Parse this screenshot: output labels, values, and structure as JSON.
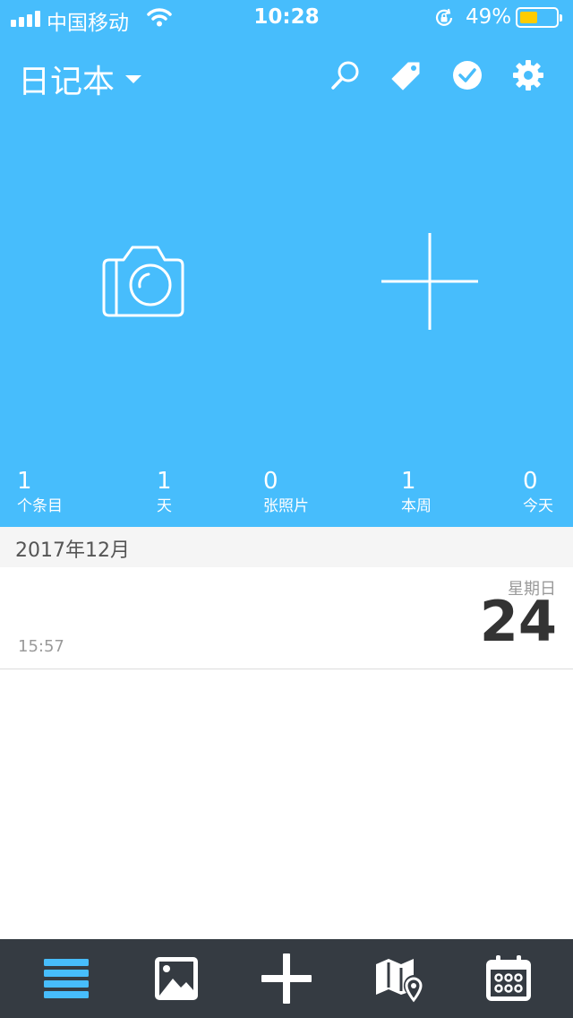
{
  "status_bar": {
    "carrier": "中国移动",
    "time": "10:28",
    "battery_percent": "49%",
    "battery_level": 0.49,
    "battery_color": "#FFCC00"
  },
  "nav": {
    "title": "日记本",
    "icons": [
      "search-icon",
      "tag-icon",
      "check-circle-icon",
      "gear-icon"
    ]
  },
  "hero": {
    "background": "#47BDFC",
    "actions": [
      "camera-icon",
      "plus-icon"
    ]
  },
  "stats": [
    {
      "value": "1",
      "label": "个条目"
    },
    {
      "value": "1",
      "label": "天"
    },
    {
      "value": "0",
      "label": "张照片"
    },
    {
      "value": "1",
      "label": "本周"
    },
    {
      "value": "0",
      "label": "今天"
    }
  ],
  "month_header": "2017年12月",
  "entries": [
    {
      "time": "15:57",
      "weekday": "星期日",
      "day": "24"
    }
  ],
  "tab_bar": {
    "background": "#353B42",
    "active_color": "#47BDFC",
    "tabs": [
      "list-icon",
      "photo-icon",
      "plus-icon",
      "map-icon",
      "calendar-icon"
    ]
  }
}
